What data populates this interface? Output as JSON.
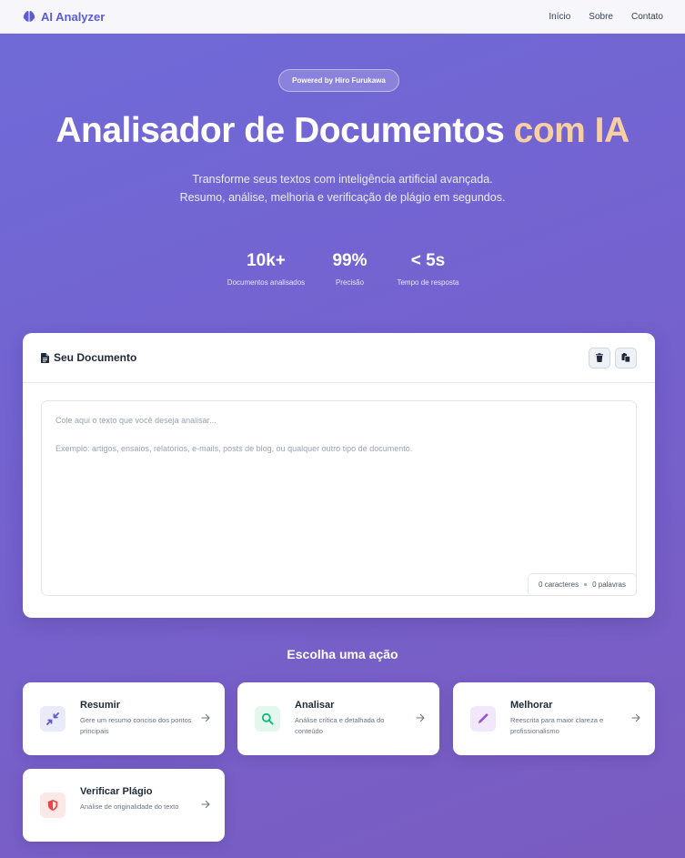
{
  "nav": {
    "brand": "AI Analyzer",
    "links": [
      "Início",
      "Sobre",
      "Contato"
    ]
  },
  "hero": {
    "badge": "Powered by Hiro Furukawa",
    "title_main": "Analisador de Documentos",
    "title_accent": "com IA",
    "subtitle": "Transforme seus textos com inteligência artificial avançada. Resumo, análise, melhoria e verificação de plágio em segundos.",
    "stats": [
      {
        "value": "10k+",
        "label": "Documentos analisados"
      },
      {
        "value": "99%",
        "label": "Precisão"
      },
      {
        "value": "< 5s",
        "label": "Tempo de resposta"
      }
    ]
  },
  "document": {
    "title": "Seu Documento",
    "placeholder_line1": "Cole aqui o texto que você deseja analisar...",
    "placeholder_line2": "Exemplo: artigos, ensaios, relatórios, e-mails, posts de blog, ou qualquer outro tipo de documento.",
    "chars": "0 caracteres",
    "words": "0 palavras",
    "icons": [
      "trash-icon",
      "paste-icon"
    ]
  },
  "actions": {
    "heading": "Escolha uma ação",
    "items": [
      {
        "title": "Resumir",
        "desc": "Gere um resumo conciso dos pontos principais",
        "icon": "compress-icon",
        "color": "#5b5bd6"
      },
      {
        "title": "Analisar",
        "desc": "Análise crítica e detalhada do conteúdo",
        "icon": "search-icon",
        "color": "#10b981"
      },
      {
        "title": "Melhorar",
        "desc": "Reescrita para maior clareza e profissionalismo",
        "icon": "pen-icon",
        "color": "#9b4fd8"
      },
      {
        "title": "Verificar Plágio",
        "desc": "Análise de originalidade do texto",
        "icon": "shield-icon",
        "color": "#ef4444"
      }
    ]
  },
  "colors": {
    "brand": "#5b5bd6",
    "accent": "#f8cfa3"
  }
}
